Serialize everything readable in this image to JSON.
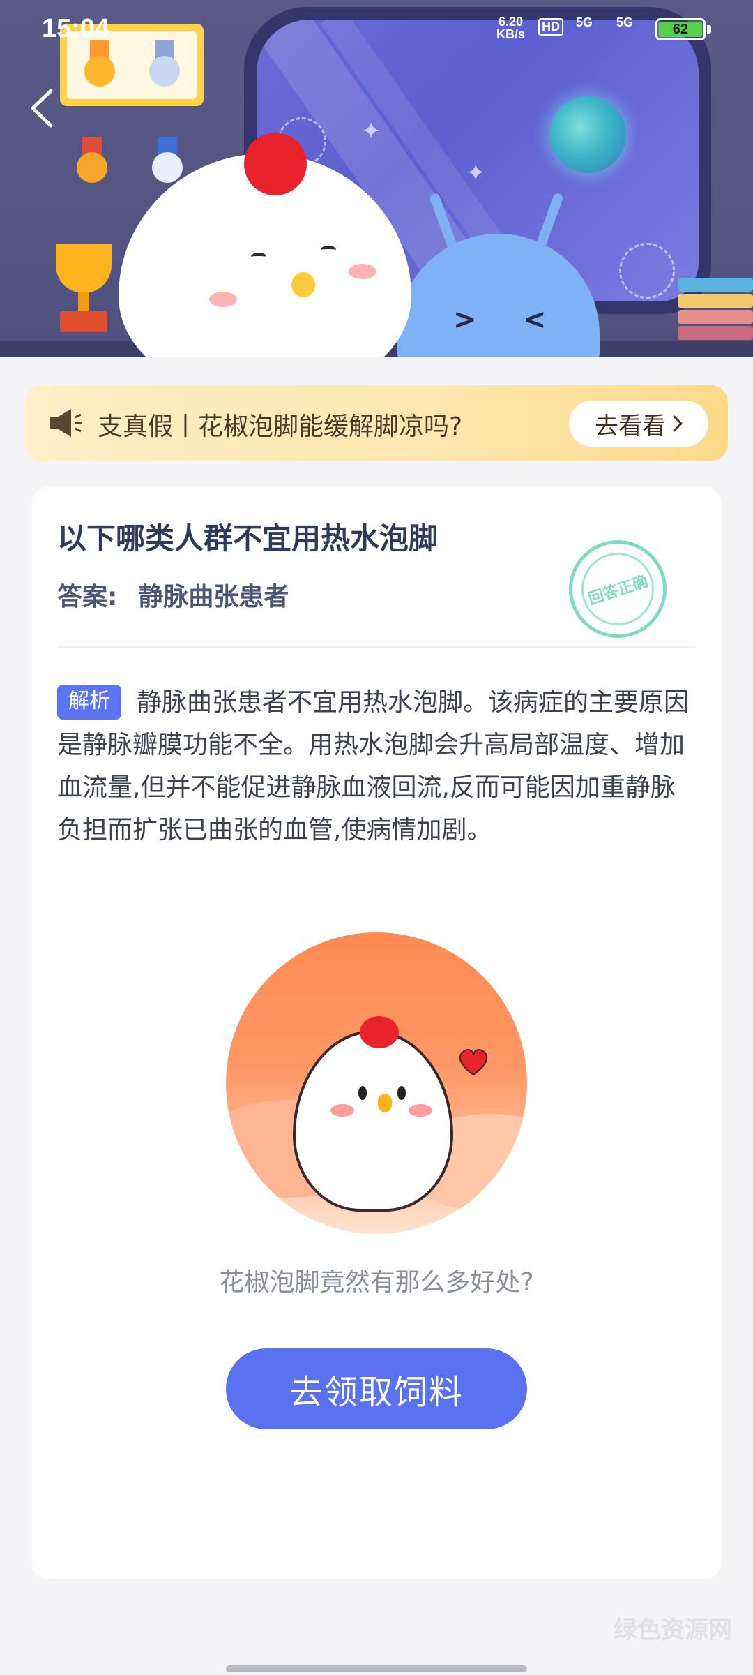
{
  "status_bar": {
    "time": "15:04",
    "net_speed": "6.20",
    "net_unit": "KB/s",
    "hd_label": "HD",
    "signal1": "5G",
    "signal2": "5G",
    "battery": "62"
  },
  "notice": {
    "text": "支真假丨花椒泡脚能缓解脚凉吗?",
    "button_label": "去看看"
  },
  "question": {
    "title": "以下哪类人群不宜用热水泡脚",
    "answer_label": "答案:",
    "answer_value": "静脉曲张患者",
    "stamp_text": "回答正确"
  },
  "analysis": {
    "tag": "解析",
    "text": "静脉曲张患者不宜用热水泡脚。该病症的主要原因是静脉瓣膜功能不全。用热水泡脚会升高局部温度、增加血流量,但并不能促进静脉血液回流,反而可能因加重静脉负担而扩张已曲张的血管,使病情加剧。"
  },
  "promo": {
    "caption": "花椒泡脚竟然有那么多好处?",
    "cta_label": "去领取饲料"
  },
  "watermark": "绿色资源网",
  "colors": {
    "accent": "#5a72f0",
    "tag": "#5b74f1",
    "notice_bg": "#ffe7ae",
    "stamp": "#7fdcc2"
  },
  "icons": [
    "back-arrow-icon",
    "megaphone-icon",
    "chevron-right-icon",
    "medal-icon",
    "trophy-icon",
    "planet-icon"
  ]
}
